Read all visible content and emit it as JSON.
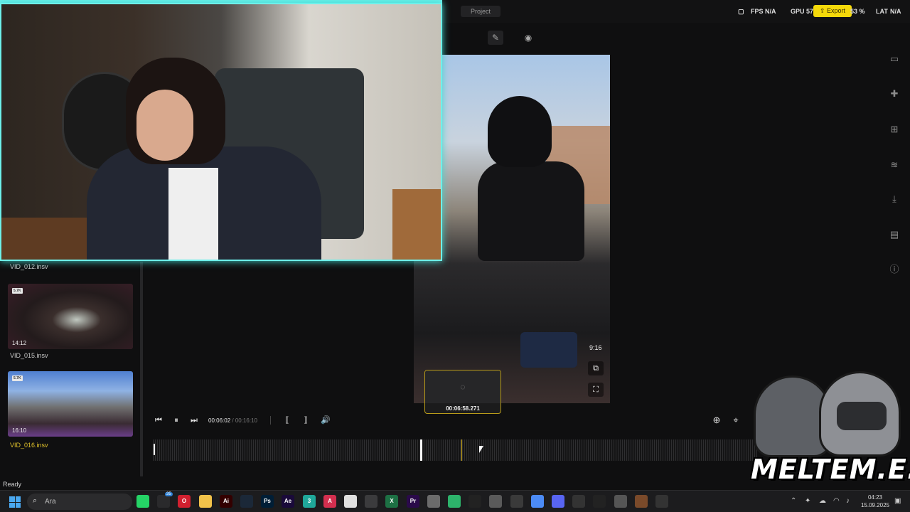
{
  "topbar": {
    "project_tab": "Project",
    "fps_label": "FPS",
    "fps_value": "N/A",
    "gpu_label": "GPU",
    "gpu_value": "57",
    "export_label": "Export",
    "cpu_value": "53 %",
    "lat_label": "LAT",
    "lat_value": "N/A"
  },
  "editor": {
    "tools": [
      {
        "icon": "edit-icon"
      },
      {
        "icon": "eye-icon"
      }
    ]
  },
  "preview": {
    "aspect_ratio": "9:16",
    "hover_timecode": "00:06:58.271"
  },
  "right_sidebar": {
    "icons": [
      "film-icon",
      "puzzle-icon",
      "import-media-icon",
      "audio-icon",
      "download-icon",
      "layers-icon",
      "info-icon"
    ]
  },
  "media_list": {
    "items": [
      {
        "name": "VID_012.insv"
      },
      {
        "name": "VID_015.insv",
        "badge": "5.7K",
        "duration": "14:12"
      },
      {
        "name": "VID_016.insv",
        "badge": "5.7K",
        "duration": "16:10",
        "selected": true
      }
    ]
  },
  "transport": {
    "current": "00:06:02",
    "separator": " / ",
    "total": "00:16:10"
  },
  "timeline": {
    "playhead_fraction": 0.442,
    "hover_fraction": 0.51
  },
  "logo_text": "MELTEM.E.T",
  "status": "Ready",
  "taskbar": {
    "search_placeholder": "Ara",
    "apps": [
      {
        "icon": "whatsapp-icon",
        "label": "",
        "color": "#25d366"
      },
      {
        "icon": "store-icon",
        "label": "",
        "color": "#2a2a2c"
      },
      {
        "icon": "opera-icon",
        "label": "O",
        "color": "#d1202f"
      },
      {
        "icon": "folder-icon",
        "label": "",
        "color": "#f1c24a"
      },
      {
        "icon": "illustrator-icon",
        "label": "Ai",
        "color": "#330000"
      },
      {
        "icon": "steam-icon",
        "label": "",
        "color": "#1b2838"
      },
      {
        "icon": "photoshop-icon",
        "label": "Ps",
        "color": "#001e36"
      },
      {
        "icon": "after-effects-icon",
        "label": "Ae",
        "color": "#1a0a3a"
      },
      {
        "icon": "app-3-icon",
        "label": "3",
        "color": "#1fa89a"
      },
      {
        "icon": "acrobat-icon",
        "label": "A",
        "color": "#d32f4f"
      },
      {
        "icon": "chrome-icon",
        "label": "",
        "color": "#e0e0e0"
      },
      {
        "icon": "calculator-icon",
        "label": "",
        "color": "#3b3b3d"
      },
      {
        "icon": "excel-icon",
        "label": "X",
        "color": "#1d7044"
      },
      {
        "icon": "premiere-icon",
        "label": "Pr",
        "color": "#2a0a4a"
      },
      {
        "icon": "image-app-icon",
        "label": "",
        "color": "#6b6b6b"
      },
      {
        "icon": "green-app-icon",
        "label": "",
        "color": "#2db36b"
      },
      {
        "icon": "capcut-icon",
        "label": "",
        "color": "#222"
      },
      {
        "icon": "paint-icon",
        "label": "",
        "color": "#5a5a5a"
      },
      {
        "icon": "settings-icon",
        "label": "",
        "color": "#3a3a3a"
      },
      {
        "icon": "chrome-alt-icon",
        "label": "",
        "color": "#4c8bf5"
      },
      {
        "icon": "discord-icon",
        "label": "",
        "color": "#5865f2"
      },
      {
        "icon": "insta360-icon",
        "label": "",
        "color": "#333"
      },
      {
        "icon": "capcut-alt-icon",
        "label": "",
        "color": "#222"
      },
      {
        "icon": "helmet-app-icon",
        "label": "",
        "color": "#555"
      },
      {
        "icon": "game-icon",
        "label": "",
        "color": "#7a4a2a"
      },
      {
        "icon": "media-player-icon",
        "label": "",
        "color": "#333"
      }
    ],
    "whatsapp_badge": "35",
    "clock_time": "04:23",
    "clock_date": "15.09.2025"
  }
}
